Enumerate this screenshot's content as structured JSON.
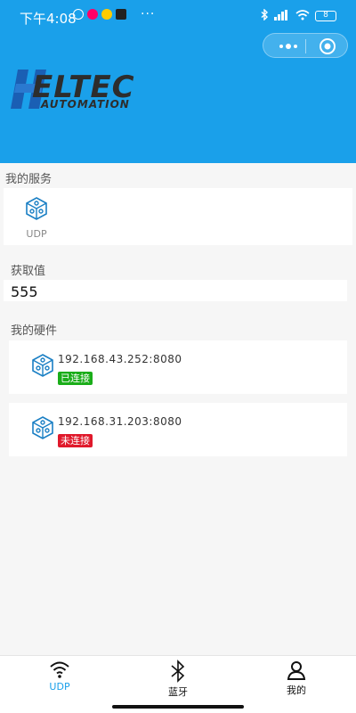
{
  "status_bar": {
    "time": "下午4:08",
    "dots": "···",
    "battery": "8"
  },
  "colors": {
    "brand": "#1aa0ea",
    "connected": "#1aad19",
    "disconnected": "#e0192b"
  },
  "sections": {
    "services_title": "我的服务",
    "value_title": "获取值",
    "hardware_title": "我的硬件"
  },
  "services": [
    {
      "icon": "cube-network-icon",
      "label": "UDP"
    }
  ],
  "value": "555",
  "hardware": [
    {
      "address": "192.168.43.252:8080",
      "status": "已连接",
      "connected": true
    },
    {
      "address": "192.168.31.203:8080",
      "status": "未连接",
      "connected": false
    }
  ],
  "tabs": [
    {
      "label": "UDP",
      "icon": "wifi-icon",
      "active": true
    },
    {
      "label": "蓝牙",
      "icon": "bluetooth-icon",
      "active": false
    },
    {
      "label": "我的",
      "icon": "user-icon",
      "active": false
    }
  ]
}
